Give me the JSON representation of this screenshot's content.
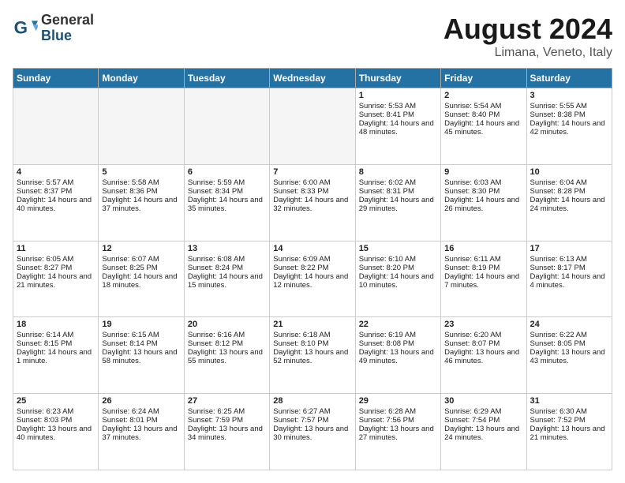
{
  "header": {
    "logo_general": "General",
    "logo_blue": "Blue",
    "month_year": "August 2024",
    "location": "Limana, Veneto, Italy"
  },
  "days_of_week": [
    "Sunday",
    "Monday",
    "Tuesday",
    "Wednesday",
    "Thursday",
    "Friday",
    "Saturday"
  ],
  "weeks": [
    [
      {
        "day": "",
        "empty": true
      },
      {
        "day": "",
        "empty": true
      },
      {
        "day": "",
        "empty": true
      },
      {
        "day": "",
        "empty": true
      },
      {
        "day": "1",
        "sunrise": "5:53 AM",
        "sunset": "8:41 PM",
        "daylight": "14 hours and 48 minutes."
      },
      {
        "day": "2",
        "sunrise": "5:54 AM",
        "sunset": "8:40 PM",
        "daylight": "14 hours and 45 minutes."
      },
      {
        "day": "3",
        "sunrise": "5:55 AM",
        "sunset": "8:38 PM",
        "daylight": "14 hours and 42 minutes."
      }
    ],
    [
      {
        "day": "4",
        "sunrise": "5:57 AM",
        "sunset": "8:37 PM",
        "daylight": "14 hours and 40 minutes."
      },
      {
        "day": "5",
        "sunrise": "5:58 AM",
        "sunset": "8:36 PM",
        "daylight": "14 hours and 37 minutes."
      },
      {
        "day": "6",
        "sunrise": "5:59 AM",
        "sunset": "8:34 PM",
        "daylight": "14 hours and 35 minutes."
      },
      {
        "day": "7",
        "sunrise": "6:00 AM",
        "sunset": "8:33 PM",
        "daylight": "14 hours and 32 minutes."
      },
      {
        "day": "8",
        "sunrise": "6:02 AM",
        "sunset": "8:31 PM",
        "daylight": "14 hours and 29 minutes."
      },
      {
        "day": "9",
        "sunrise": "6:03 AM",
        "sunset": "8:30 PM",
        "daylight": "14 hours and 26 minutes."
      },
      {
        "day": "10",
        "sunrise": "6:04 AM",
        "sunset": "8:28 PM",
        "daylight": "14 hours and 24 minutes."
      }
    ],
    [
      {
        "day": "11",
        "sunrise": "6:05 AM",
        "sunset": "8:27 PM",
        "daylight": "14 hours and 21 minutes."
      },
      {
        "day": "12",
        "sunrise": "6:07 AM",
        "sunset": "8:25 PM",
        "daylight": "14 hours and 18 minutes."
      },
      {
        "day": "13",
        "sunrise": "6:08 AM",
        "sunset": "8:24 PM",
        "daylight": "14 hours and 15 minutes."
      },
      {
        "day": "14",
        "sunrise": "6:09 AM",
        "sunset": "8:22 PM",
        "daylight": "14 hours and 12 minutes."
      },
      {
        "day": "15",
        "sunrise": "6:10 AM",
        "sunset": "8:20 PM",
        "daylight": "14 hours and 10 minutes."
      },
      {
        "day": "16",
        "sunrise": "6:11 AM",
        "sunset": "8:19 PM",
        "daylight": "14 hours and 7 minutes."
      },
      {
        "day": "17",
        "sunrise": "6:13 AM",
        "sunset": "8:17 PM",
        "daylight": "14 hours and 4 minutes."
      }
    ],
    [
      {
        "day": "18",
        "sunrise": "6:14 AM",
        "sunset": "8:15 PM",
        "daylight": "14 hours and 1 minute."
      },
      {
        "day": "19",
        "sunrise": "6:15 AM",
        "sunset": "8:14 PM",
        "daylight": "13 hours and 58 minutes."
      },
      {
        "day": "20",
        "sunrise": "6:16 AM",
        "sunset": "8:12 PM",
        "daylight": "13 hours and 55 minutes."
      },
      {
        "day": "21",
        "sunrise": "6:18 AM",
        "sunset": "8:10 PM",
        "daylight": "13 hours and 52 minutes."
      },
      {
        "day": "22",
        "sunrise": "6:19 AM",
        "sunset": "8:08 PM",
        "daylight": "13 hours and 49 minutes."
      },
      {
        "day": "23",
        "sunrise": "6:20 AM",
        "sunset": "8:07 PM",
        "daylight": "13 hours and 46 minutes."
      },
      {
        "day": "24",
        "sunrise": "6:22 AM",
        "sunset": "8:05 PM",
        "daylight": "13 hours and 43 minutes."
      }
    ],
    [
      {
        "day": "25",
        "sunrise": "6:23 AM",
        "sunset": "8:03 PM",
        "daylight": "13 hours and 40 minutes."
      },
      {
        "day": "26",
        "sunrise": "6:24 AM",
        "sunset": "8:01 PM",
        "daylight": "13 hours and 37 minutes."
      },
      {
        "day": "27",
        "sunrise": "6:25 AM",
        "sunset": "7:59 PM",
        "daylight": "13 hours and 34 minutes."
      },
      {
        "day": "28",
        "sunrise": "6:27 AM",
        "sunset": "7:57 PM",
        "daylight": "13 hours and 30 minutes."
      },
      {
        "day": "29",
        "sunrise": "6:28 AM",
        "sunset": "7:56 PM",
        "daylight": "13 hours and 27 minutes."
      },
      {
        "day": "30",
        "sunrise": "6:29 AM",
        "sunset": "7:54 PM",
        "daylight": "13 hours and 24 minutes."
      },
      {
        "day": "31",
        "sunrise": "6:30 AM",
        "sunset": "7:52 PM",
        "daylight": "13 hours and 21 minutes."
      }
    ]
  ],
  "labels": {
    "sunrise": "Sunrise:",
    "sunset": "Sunset:",
    "daylight": "Daylight:"
  }
}
